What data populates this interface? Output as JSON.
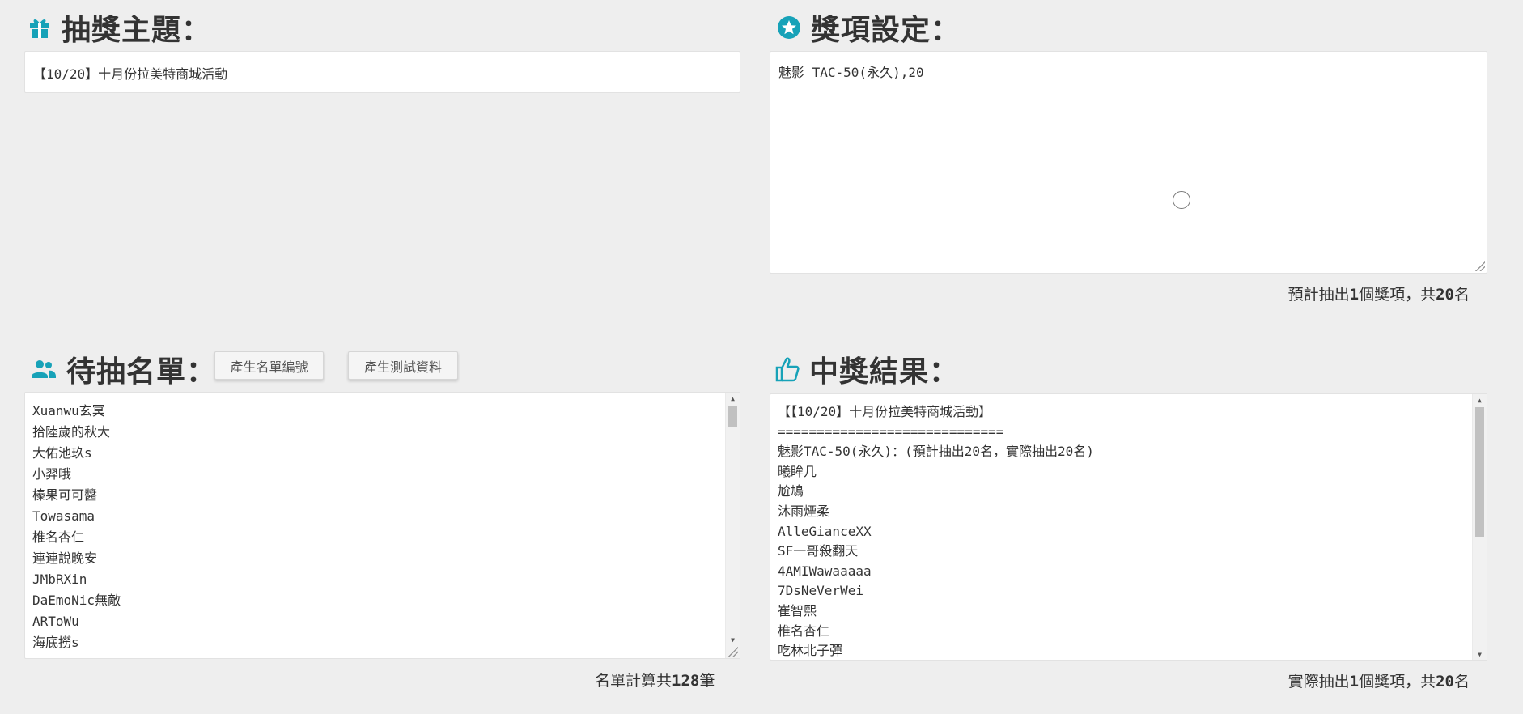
{
  "colors": {
    "accent": "#17a2b8",
    "background": "#eeeeee"
  },
  "subject": {
    "icon": "gift-icon",
    "heading": "抽獎主題：",
    "value": "【10/20】十月份拉美特商城活動"
  },
  "prizes": {
    "icon": "star-circle-icon",
    "heading": "獎項設定：",
    "value": "魅影 TAC-50(永久),20",
    "status_prefix": "預計抽出",
    "status_count": "1",
    "status_mid": "個獎項，共",
    "status_total": "20",
    "status_suffix": "名"
  },
  "candidates": {
    "icon": "users-icon",
    "heading": "待抽名單：",
    "btn_number": "產生名單編號",
    "btn_test": "產生測試資料",
    "items": [
      "Xuanwu玄冥",
      "拾陸歲的秋大",
      "大佑池玖s",
      "小羿哦",
      "榛果可可醬",
      "Towasama",
      "椎名杏仁",
      "連連說晚安",
      "JMbRXin",
      "DaEmoNic無敵",
      "ARToWu",
      "海底撈s"
    ],
    "status_prefix": "名單計算共",
    "status_total": "128",
    "status_suffix": "筆"
  },
  "results": {
    "icon": "thumbs-up-icon",
    "heading": "中獎結果：",
    "lines": [
      "【【10/20】十月份拉美特商城活動】",
      "=============================",
      "魅影TAC-50(永久)：(預計抽出20名，實際抽出20名)",
      "曦眸几",
      "尬鳩",
      "沐雨煙柔",
      "AlleGianceXX",
      "SF一哥殺翻天",
      "4AMIWawaaaaa",
      "7DsNeVerWei",
      "崔智熙",
      "椎名杏仁",
      "吃林北子彈"
    ],
    "status_prefix": "實際抽出",
    "status_count": "1",
    "status_mid": "個獎項，共",
    "status_total": "20",
    "status_suffix": "名"
  }
}
